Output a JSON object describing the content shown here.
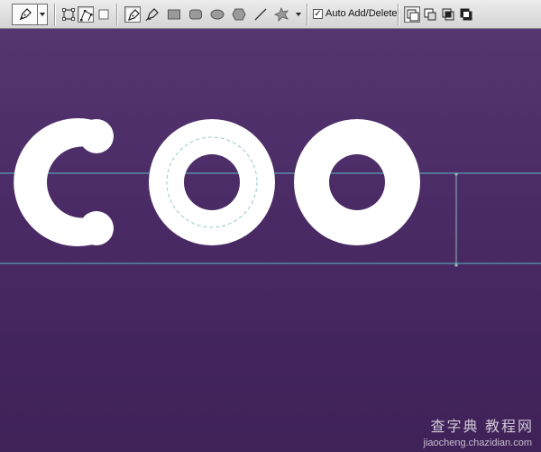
{
  "toolbar": {
    "tool_preset": {
      "icon": "pen-tool-icon"
    },
    "path_modes": [
      {
        "icon": "shape-layers-icon"
      },
      {
        "icon": "paths-icon",
        "selected": true
      },
      {
        "icon": "fill-pixels-icon"
      }
    ],
    "drawing_tools": [
      {
        "icon": "pen-icon",
        "selected": true
      },
      {
        "icon": "freeform-pen-icon"
      },
      {
        "icon": "rectangle-icon"
      },
      {
        "icon": "rounded-rectangle-icon"
      },
      {
        "icon": "ellipse-icon"
      },
      {
        "icon": "polygon-icon"
      },
      {
        "icon": "line-icon"
      },
      {
        "icon": "custom-shape-icon"
      }
    ],
    "auto_add_delete": {
      "checked": true,
      "label": "Auto Add/Delete",
      "check_glyph": "✓"
    },
    "path_operations": [
      {
        "icon": "add-to-shape-area-icon",
        "selected": true
      },
      {
        "icon": "subtract-from-shape-area-icon"
      },
      {
        "icon": "intersect-shape-areas-icon"
      },
      {
        "icon": "exclude-overlapping-shape-areas-icon"
      }
    ]
  },
  "canvas": {
    "text": "COO",
    "background_colors": [
      "#553670",
      "#3f2258"
    ],
    "letter_color": "#ffffff",
    "guide_color": "#5fd3d8"
  },
  "watermark": {
    "title": "查字典 教程网",
    "url": "jiaocheng.chazidian.com"
  }
}
